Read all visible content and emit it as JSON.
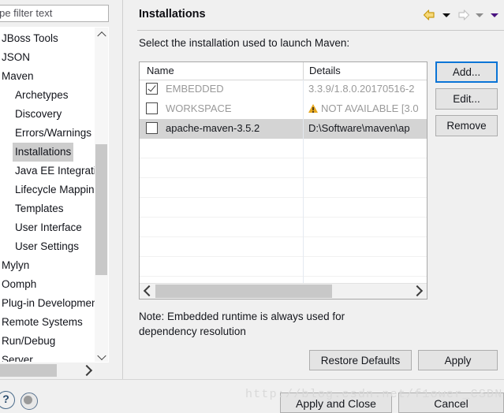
{
  "filter": {
    "value": "",
    "placeholder": "type filter text"
  },
  "sidebar": {
    "items": [
      {
        "label": "JBoss Tools",
        "depth": 0,
        "expander": "none",
        "selected": false
      },
      {
        "label": "JSON",
        "depth": 0,
        "expander": "none",
        "selected": false
      },
      {
        "label": "Maven",
        "depth": 0,
        "expander": "open",
        "selected": false
      },
      {
        "label": "Archetypes",
        "depth": 1,
        "expander": "none",
        "selected": false
      },
      {
        "label": "Discovery",
        "depth": 1,
        "expander": "none",
        "selected": false
      },
      {
        "label": "Errors/Warnings",
        "depth": 1,
        "expander": "none",
        "selected": false
      },
      {
        "label": "Installations",
        "depth": 1,
        "expander": "none",
        "selected": true
      },
      {
        "label": "Java EE Integration",
        "depth": 1,
        "expander": "none",
        "selected": false
      },
      {
        "label": "Lifecycle Mappings",
        "depth": 1,
        "expander": "none",
        "selected": false
      },
      {
        "label": "Templates",
        "depth": 1,
        "expander": "none",
        "selected": false
      },
      {
        "label": "User Interface",
        "depth": 1,
        "expander": "none",
        "selected": false
      },
      {
        "label": "User Settings",
        "depth": 1,
        "expander": "none",
        "selected": false
      },
      {
        "label": "Mylyn",
        "depth": 0,
        "expander": "none",
        "selected": false
      },
      {
        "label": "Oomph",
        "depth": 0,
        "expander": "none",
        "selected": false
      },
      {
        "label": "Plug-in Development",
        "depth": 0,
        "expander": "none",
        "selected": false
      },
      {
        "label": "Remote Systems",
        "depth": 0,
        "expander": "none",
        "selected": false
      },
      {
        "label": "Run/Debug",
        "depth": 0,
        "expander": "none",
        "selected": false
      },
      {
        "label": "Server",
        "depth": 0,
        "expander": "none",
        "selected": false
      }
    ]
  },
  "page": {
    "title": "Installations",
    "instruction": "Select the installation used to launch Maven:",
    "note": "Note: Embedded runtime is always used for dependency resolution"
  },
  "nav": {
    "back_icon": "back-arrow-icon",
    "back_menu_icon": "chevron-down-icon",
    "forward_icon": "forward-arrow-icon",
    "forward_menu_icon": "chevron-down-icon",
    "view_menu_icon": "chevron-down-icon",
    "back_color": "#e8b51f",
    "forward_color": "#c9c9c9",
    "view_menu_color": "#5b1a8a"
  },
  "table": {
    "columns": [
      "Name",
      "Details"
    ],
    "rows": [
      {
        "checked": true,
        "name": "EMBEDDED",
        "details": "3.3.9/1.8.0.20170516-2",
        "warning": false,
        "dimmed": true,
        "highlight": false
      },
      {
        "checked": false,
        "name": "WORKSPACE",
        "details": "NOT AVAILABLE [3.0",
        "warning": true,
        "dimmed": true,
        "highlight": false
      },
      {
        "checked": false,
        "name": "apache-maven-3.5.2",
        "details": "D:\\Software\\maven\\ap",
        "warning": false,
        "dimmed": false,
        "highlight": true
      }
    ],
    "empty_row_count": 8
  },
  "buttons": {
    "add": "Add...",
    "edit": "Edit...",
    "remove": "Remove",
    "restore_defaults": "Restore Defaults",
    "apply": "Apply",
    "apply_and_close": "Apply and Close",
    "cancel": "Cancel"
  },
  "bottom": {
    "help_icon": "question-mark-icon",
    "help_glyph": "?",
    "progress_icon": "progress-indicator-icon"
  },
  "watermark": {
    "text": "http://blog.csdn.net/f1ower_CSDN"
  }
}
